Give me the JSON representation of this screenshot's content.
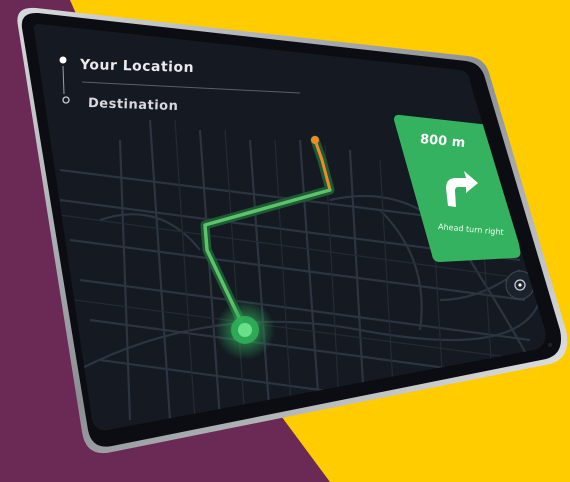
{
  "route_panel": {
    "origin_label": "Your Location",
    "destination_label": "Destination"
  },
  "turn_sign": {
    "distance": "800 m",
    "instruction": "Ahead turn right",
    "icon": "turn-right-arrow-icon"
  },
  "colors": {
    "background_left": "#6b2a55",
    "background_right": "#ffcc00",
    "screen": "#12161e",
    "route_green": "#5cc36a",
    "route_orange": "#f08a24",
    "sign_green": "#35b260"
  }
}
